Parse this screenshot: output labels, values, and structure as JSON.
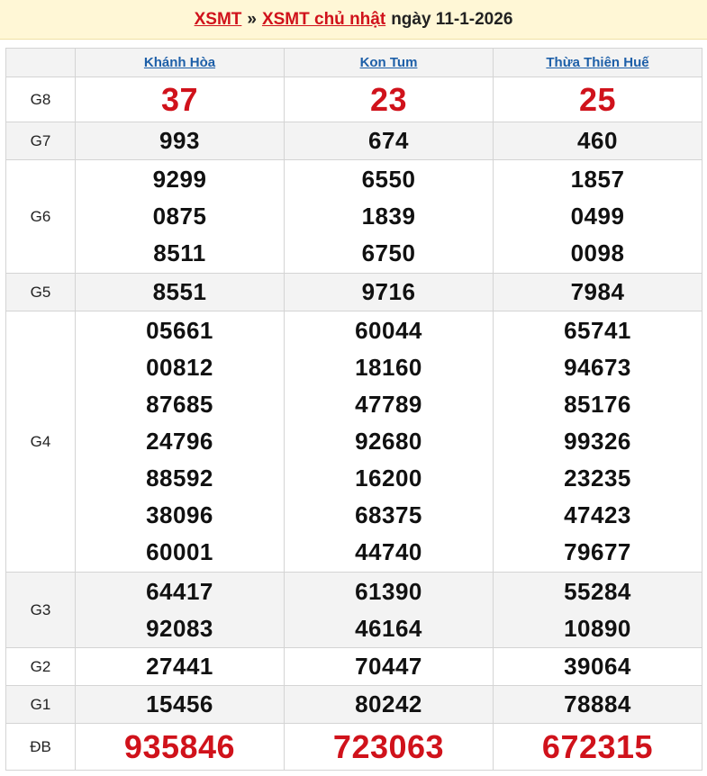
{
  "header": {
    "link1": "XSMT",
    "separator": "»",
    "link2": "XSMT chủ nhật",
    "date_text": "ngày 11-1-2026"
  },
  "table": {
    "provinces": [
      "Khánh Hòa",
      "Kon Tum",
      "Thừa Thiên Huế"
    ],
    "prizes": [
      {
        "label": "G8",
        "style": "red",
        "values": [
          [
            "37"
          ],
          [
            "23"
          ],
          [
            "25"
          ]
        ]
      },
      {
        "label": "G7",
        "style": "normal",
        "values": [
          [
            "993"
          ],
          [
            "674"
          ],
          [
            "460"
          ]
        ]
      },
      {
        "label": "G6",
        "style": "normal",
        "values": [
          [
            "9299",
            "0875",
            "8511"
          ],
          [
            "6550",
            "1839",
            "6750"
          ],
          [
            "1857",
            "0499",
            "0098"
          ]
        ]
      },
      {
        "label": "G5",
        "style": "normal",
        "values": [
          [
            "8551"
          ],
          [
            "9716"
          ],
          [
            "7984"
          ]
        ]
      },
      {
        "label": "G4",
        "style": "normal",
        "values": [
          [
            "05661",
            "00812",
            "87685",
            "24796",
            "88592",
            "38096",
            "60001"
          ],
          [
            "60044",
            "18160",
            "47789",
            "92680",
            "16200",
            "68375",
            "44740"
          ],
          [
            "65741",
            "94673",
            "85176",
            "99326",
            "23235",
            "47423",
            "79677"
          ]
        ]
      },
      {
        "label": "G3",
        "style": "normal",
        "values": [
          [
            "64417",
            "92083"
          ],
          [
            "61390",
            "46164"
          ],
          [
            "55284",
            "10890"
          ]
        ]
      },
      {
        "label": "G2",
        "style": "normal",
        "values": [
          [
            "27441"
          ],
          [
            "70447"
          ],
          [
            "39064"
          ]
        ]
      },
      {
        "label": "G1",
        "style": "normal",
        "values": [
          [
            "15456"
          ],
          [
            "80242"
          ],
          [
            "78884"
          ]
        ]
      },
      {
        "label": "ĐB",
        "style": "red",
        "values": [
          [
            "935846"
          ],
          [
            "723063"
          ],
          [
            "672315"
          ]
        ]
      }
    ]
  },
  "colors": {
    "red_number": "#d0121b",
    "link_blue": "#1d5fa8",
    "title_bg": "#fff7d6",
    "alt_row_bg": "#f3f3f3"
  }
}
